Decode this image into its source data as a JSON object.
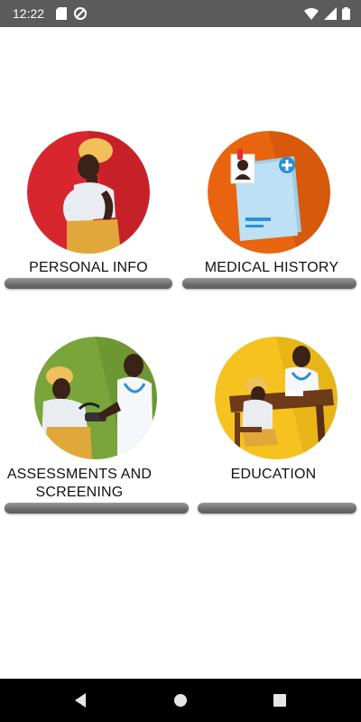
{
  "status": {
    "time": "12:22",
    "icons": [
      "sd-card-icon",
      "do-not-disturb-icon",
      "wifi-icon",
      "signal-icon",
      "battery-icon"
    ]
  },
  "tiles": [
    {
      "label": "PERSONAL INFO",
      "color": "#d8262e",
      "icon": "pregnant-woman-illustration"
    },
    {
      "label": "MEDICAL HISTORY",
      "color": "#e8640f",
      "icon": "medical-records-illustration"
    },
    {
      "label": "ASSESSMENTS AND SCREENING",
      "color": "#7aa53b",
      "icon": "blood-pressure-check-illustration"
    },
    {
      "label": "EDUCATION",
      "color": "#f5c21f",
      "icon": "doctor-consultation-illustration"
    }
  ],
  "nav": {
    "buttons": [
      "back-icon",
      "home-icon",
      "recents-icon"
    ]
  }
}
